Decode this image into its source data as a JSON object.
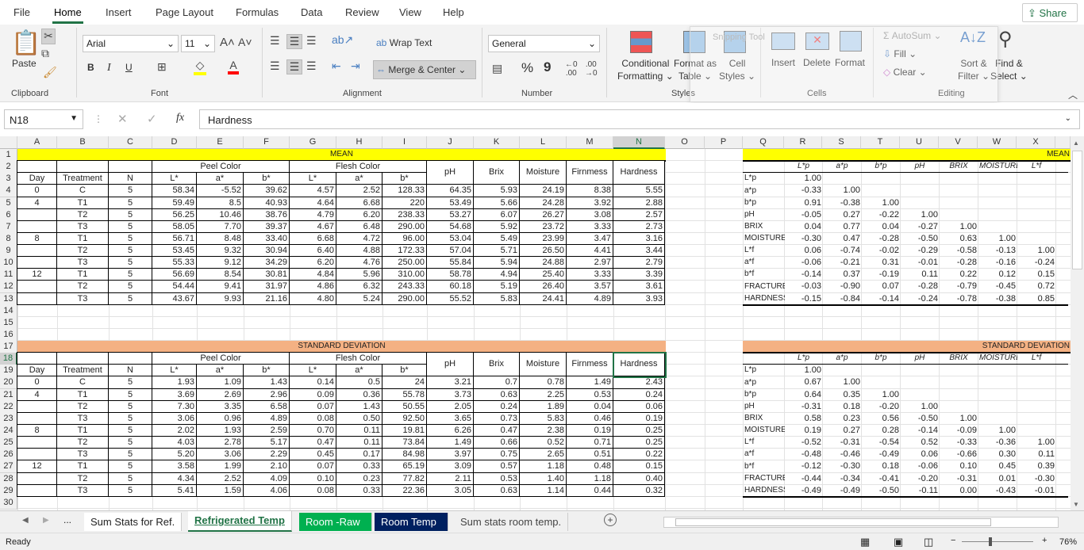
{
  "menu": {
    "items": [
      "File",
      "Home",
      "Insert",
      "Page Layout",
      "Formulas",
      "Data",
      "Review",
      "View",
      "Help"
    ],
    "active": "Home",
    "share": "Share"
  },
  "ribbon": {
    "clipboard": {
      "paste": "Paste",
      "label": "Clipboard"
    },
    "font": {
      "name": "Arial",
      "size": "11",
      "bold": "B",
      "italic": "I",
      "underline": "U",
      "label": "Font",
      "fill_color": "#ffff00",
      "font_color": "#ff0000"
    },
    "alignment": {
      "wrap": "Wrap Text",
      "merge": "Merge & Center",
      "label": "Alignment"
    },
    "number": {
      "format": "General",
      "percent": "%",
      "comma": "9",
      "label": "Number"
    },
    "styles": {
      "conditional": "Conditional",
      "conditional2": "Formatting",
      "format_table": "Format as",
      "format_table2": "Table",
      "cell_styles": "Cell",
      "cell_styles2": "Styles",
      "label": "Styles"
    },
    "cells": {
      "insert": "Insert",
      "delete": "Delete",
      "format": "Format",
      "label": "Cells"
    },
    "editing": {
      "autosum": "AutoSum",
      "fill": "Fill",
      "clear": "Clear",
      "sort": "Sort &",
      "sort2": "Filter",
      "find": "Find &",
      "find2": "Select",
      "label": "Editing"
    },
    "snipping_tool": "Snipping Tool"
  },
  "formula_bar": {
    "name_box": "N18",
    "fx": "fx",
    "value": "Hardness"
  },
  "grid": {
    "columns": [
      "A",
      "B",
      "C",
      "D",
      "E",
      "F",
      "G",
      "H",
      "I",
      "J",
      "K",
      "L",
      "M",
      "N",
      "O",
      "P",
      "Q",
      "R",
      "S",
      "T",
      "U",
      "V",
      "W",
      "X"
    ],
    "selected_column": "N",
    "selected_row": 18,
    "row_count": 30
  },
  "mean_table": {
    "title": "MEAN",
    "peel": "Peel Color",
    "flesh": "Flesh Color",
    "headers": [
      "Day",
      "Treatment",
      "N",
      "L*",
      "a*",
      "b*",
      "L*",
      "a*",
      "b*"
    ],
    "measures": [
      "pH",
      "Brix",
      "Moisture",
      "Firnmess",
      "Hardness"
    ],
    "rows": [
      [
        "0",
        "C",
        "5",
        "58.34",
        "-5.52",
        "39.62",
        "4.57",
        "2.52",
        "128.33",
        "64.35",
        "5.93",
        "24.19",
        "8.38",
        "5.55"
      ],
      [
        "4",
        "T1",
        "5",
        "59.49",
        "8.5",
        "40.93",
        "4.64",
        "6.68",
        "220",
        "53.49",
        "5.66",
        "24.28",
        "3.92",
        "2.88"
      ],
      [
        "",
        "T2",
        "5",
        "56.25",
        "10.46",
        "38.76",
        "4.79",
        "6.20",
        "238.33",
        "53.27",
        "6.07",
        "26.27",
        "3.08",
        "2.57"
      ],
      [
        "",
        "T3",
        "5",
        "58.05",
        "7.70",
        "39.37",
        "4.67",
        "6.48",
        "290.00",
        "54.68",
        "5.92",
        "23.72",
        "3.33",
        "2.73"
      ],
      [
        "8",
        "T1",
        "5",
        "56.71",
        "8.48",
        "33.40",
        "6.68",
        "4.72",
        "96.00",
        "53.04",
        "5.49",
        "23.99",
        "3.47",
        "3.16"
      ],
      [
        "",
        "T2",
        "5",
        "53.45",
        "9.32",
        "30.94",
        "6.40",
        "4.88",
        "172.33",
        "57.04",
        "5.71",
        "26.50",
        "4.41",
        "3.44"
      ],
      [
        "",
        "T3",
        "5",
        "55.33",
        "9.12",
        "34.29",
        "6.20",
        "4.76",
        "250.00",
        "55.84",
        "5.94",
        "24.88",
        "2.97",
        "2.79"
      ],
      [
        "12",
        "T1",
        "5",
        "56.69",
        "8.54",
        "30.81",
        "4.84",
        "5.96",
        "310.00",
        "58.78",
        "4.94",
        "25.40",
        "3.33",
        "3.39"
      ],
      [
        "",
        "T2",
        "5",
        "54.44",
        "9.41",
        "31.97",
        "4.86",
        "6.32",
        "243.33",
        "60.18",
        "5.19",
        "26.40",
        "3.57",
        "3.61"
      ],
      [
        "",
        "T3",
        "5",
        "43.67",
        "9.93",
        "21.16",
        "4.80",
        "5.24",
        "290.00",
        "55.52",
        "5.83",
        "24.41",
        "4.89",
        "3.93"
      ]
    ]
  },
  "sd_table": {
    "title": "STANDARD DEVIATION",
    "peel": "Peel Color",
    "flesh": "Flesh Color",
    "headers": [
      "Day",
      "Treatment",
      "N",
      "L*",
      "a*",
      "b*",
      "L*",
      "a*",
      "b*"
    ],
    "measures": [
      "pH",
      "Brix",
      "Moisture",
      "Firnmess",
      "Hardness"
    ],
    "rows": [
      [
        "0",
        "C",
        "5",
        "1.93",
        "1.09",
        "1.43",
        "0.14",
        "0.5",
        "24",
        "3.21",
        "0.7",
        "0.78",
        "1.49",
        "2.43"
      ],
      [
        "4",
        "T1",
        "5",
        "3.69",
        "2.69",
        "2.96",
        "0.09",
        "0.36",
        "55.78",
        "3.73",
        "0.63",
        "2.25",
        "0.53",
        "0.24"
      ],
      [
        "",
        "T2",
        "5",
        "7.30",
        "3.35",
        "6.58",
        "0.07",
        "1.43",
        "50.55",
        "2.05",
        "0.24",
        "1.89",
        "0.04",
        "0.06"
      ],
      [
        "",
        "T3",
        "5",
        "3.06",
        "0.96",
        "4.89",
        "0.08",
        "0.50",
        "92.50",
        "3.65",
        "0.73",
        "5.83",
        "0.46",
        "0.19"
      ],
      [
        "8",
        "T1",
        "5",
        "2.02",
        "1.93",
        "2.59",
        "0.70",
        "0.11",
        "19.81",
        "6.26",
        "0.47",
        "2.38",
        "0.19",
        "0.25"
      ],
      [
        "",
        "T2",
        "5",
        "4.03",
        "2.78",
        "5.17",
        "0.47",
        "0.11",
        "73.84",
        "1.49",
        "0.66",
        "0.52",
        "0.71",
        "0.25"
      ],
      [
        "",
        "T3",
        "5",
        "5.20",
        "3.06",
        "2.29",
        "0.45",
        "0.17",
        "84.98",
        "3.97",
        "0.75",
        "2.65",
        "0.51",
        "0.22"
      ],
      [
        "12",
        "T1",
        "5",
        "3.58",
        "1.99",
        "2.10",
        "0.07",
        "0.33",
        "65.19",
        "3.09",
        "0.57",
        "1.18",
        "0.48",
        "0.15"
      ],
      [
        "",
        "T2",
        "5",
        "4.34",
        "2.52",
        "4.09",
        "0.10",
        "0.23",
        "77.82",
        "2.11",
        "0.53",
        "1.40",
        "1.18",
        "0.40"
      ],
      [
        "",
        "T3",
        "5",
        "5.41",
        "1.59",
        "4.06",
        "0.08",
        "0.33",
        "22.36",
        "3.05",
        "0.63",
        "1.14",
        "0.44",
        "0.32"
      ]
    ]
  },
  "corr_mean": {
    "title": "MEAN",
    "col_headers": [
      "L*p",
      "a*p",
      "b*p",
      "pH",
      "BRIX",
      "MOISTURE (%",
      "L*f"
    ],
    "row_labels": [
      "L*p",
      "a*p",
      "b*p",
      "pH",
      "BRIX",
      "MOISTURE",
      "L*f",
      "a*f",
      "b*f",
      "FRACTURE",
      "HARDNESS"
    ],
    "values": [
      [
        "1.00"
      ],
      [
        "-0.33",
        "1.00"
      ],
      [
        "0.91",
        "-0.38",
        "1.00"
      ],
      [
        "-0.05",
        "0.27",
        "-0.22",
        "1.00"
      ],
      [
        "0.04",
        "0.77",
        "0.04",
        "-0.27",
        "1.00"
      ],
      [
        "-0.30",
        "0.47",
        "-0.28",
        "-0.50",
        "0.63",
        "1.00"
      ],
      [
        "0.06",
        "-0.74",
        "-0.02",
        "-0.29",
        "-0.58",
        "-0.13",
        "1.00"
      ],
      [
        "-0.06",
        "-0.21",
        "0.31",
        "-0.01",
        "-0.28",
        "-0.16",
        "-0.24"
      ],
      [
        "-0.14",
        "0.37",
        "-0.19",
        "0.11",
        "0.22",
        "0.12",
        "0.15"
      ],
      [
        "-0.03",
        "-0.90",
        "0.07",
        "-0.28",
        "-0.79",
        "-0.45",
        "0.72"
      ],
      [
        "-0.15",
        "-0.84",
        "-0.14",
        "-0.24",
        "-0.78",
        "-0.38",
        "0.85"
      ]
    ]
  },
  "corr_sd": {
    "title": "STANDARD DEVIATION",
    "col_headers": [
      "L*p",
      "a*p",
      "b*p",
      "pH",
      "BRIX",
      "MOISTURE (%",
      "L*f"
    ],
    "row_labels": [
      "L*p",
      "a*p",
      "b*p",
      "pH",
      "BRIX",
      "MOISTURE",
      "L*f",
      "a*f",
      "b*f",
      "FRACTURE",
      "HARDNESS"
    ],
    "values": [
      [
        "1.00"
      ],
      [
        "0.67",
        "1.00"
      ],
      [
        "0.64",
        "0.35",
        "1.00"
      ],
      [
        "-0.31",
        "0.18",
        "-0.20",
        "1.00"
      ],
      [
        "0.58",
        "0.23",
        "0.56",
        "-0.50",
        "1.00"
      ],
      [
        "0.19",
        "0.27",
        "0.28",
        "-0.14",
        "-0.09",
        "1.00"
      ],
      [
        "-0.52",
        "-0.31",
        "-0.54",
        "0.52",
        "-0.33",
        "-0.36",
        "1.00"
      ],
      [
        "-0.48",
        "-0.46",
        "-0.49",
        "0.06",
        "-0.66",
        "0.30",
        "0.11"
      ],
      [
        "-0.12",
        "-0.30",
        "0.18",
        "-0.06",
        "0.10",
        "0.45",
        "0.39"
      ],
      [
        "-0.44",
        "-0.34",
        "-0.41",
        "-0.20",
        "-0.31",
        "0.01",
        "-0.30"
      ],
      [
        "-0.49",
        "-0.49",
        "-0.50",
        "-0.11",
        "0.00",
        "-0.43",
        "-0.01"
      ]
    ]
  },
  "colors": {
    "mean_fill": "#ffff00",
    "sd_fill": "#f4b183",
    "excel_green": "#217346",
    "room_raw_tab": "#00b050",
    "room_temp_tab": "#002060"
  },
  "sheet_tabs": {
    "more": "...",
    "tabs": [
      "Sum Stats for Ref.",
      "Refrigerated Temp",
      "Room -Raw",
      "Room Temp",
      "Sum stats room temp."
    ],
    "active": "Refrigerated Temp",
    "add": "+"
  },
  "status": {
    "ready": "Ready",
    "zoom": "76%"
  }
}
